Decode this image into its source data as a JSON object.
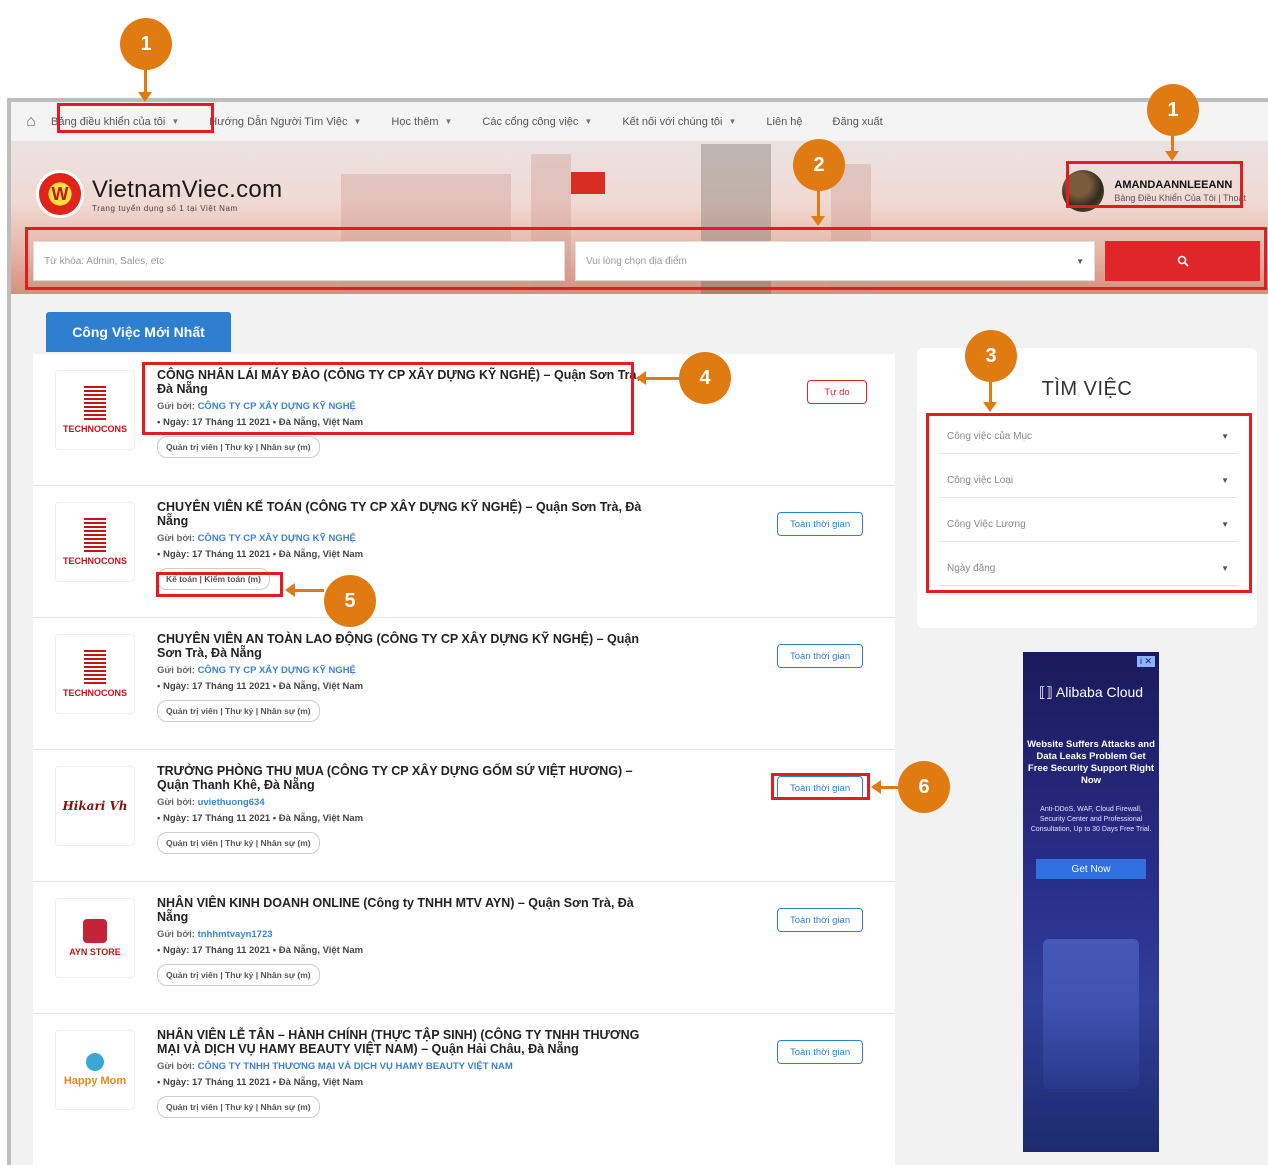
{
  "nav": {
    "items": [
      {
        "label": "Bảng điều khiển của tôi"
      },
      {
        "label": "Hướng Dẫn Người Tìm Việc"
      },
      {
        "label": "Học thêm"
      },
      {
        "label": "Các cổng công việc"
      },
      {
        "label": "Kết nối với chúng tôi"
      },
      {
        "label": "Liên hệ"
      },
      {
        "label": "Đăng xuất"
      }
    ]
  },
  "brand": {
    "name": "VietnamViec.com",
    "tagline": "Trang tuyển dụng số 1 tại Việt Nam",
    "logo_letter": "W"
  },
  "user": {
    "name": "AMANDAANNLEEANN",
    "dashboard": "Bảng Điều Khiển Của Tôi",
    "sep": "|",
    "logout": "Thoát"
  },
  "search": {
    "keyword_placeholder": "Từ khóa: Admin, Sales, etc",
    "location_placeholder": "Vui lòng chọn địa điểm",
    "button_icon": "search-icon"
  },
  "tab": {
    "label": "Công Việc Mới Nhất"
  },
  "jobs": [
    {
      "title": "CÔNG NHÂN LÁI MÁY ĐÀO (CÔNG TY CP XÂY DỰNG KỸ NGHỆ) – Quận Sơn Trà, Đà Nẵng",
      "poster_prefix": "Gửi bởi:",
      "poster": "CÔNG TY CP XÂY DỰNG KỸ NGHỆ",
      "date": "Ngày: 17 Tháng 11 2021",
      "location": "Đà Nẵng, Việt Nam",
      "tag": "Quản trị viên | Thư ký | Nhân sự (m)",
      "badge": "Tự do",
      "logo": "TECHNOCONS"
    },
    {
      "title": "CHUYÊN VIÊN KẾ TOÁN (CÔNG TY CP XÂY DỰNG KỸ NGHỆ) – Quận Sơn Trà, Đà Nẵng",
      "poster_prefix": "Gửi bởi:",
      "poster": "CÔNG TY CP XÂY DỰNG KỸ NGHỆ",
      "date": "Ngày: 17 Tháng 11 2021",
      "location": "Đà Nẵng, Việt Nam",
      "tag": "Kế toán | Kiểm toán (m)",
      "badge": "Toàn thời gian",
      "logo": "TECHNOCONS"
    },
    {
      "title": "CHUYÊN VIÊN AN TOÀN LAO ĐỘNG (CÔNG TY CP XÂY DỰNG KỸ NGHỆ) – Quận Sơn Trà, Đà Nẵng",
      "poster_prefix": "Gửi bởi:",
      "poster": "CÔNG TY CP XÂY DỰNG KỸ NGHỆ",
      "date": "Ngày: 17 Tháng 11 2021",
      "location": "Đà Nẵng, Việt Nam",
      "tag": "Quản trị viên | Thư ký | Nhân sự (m)",
      "badge": "Toàn thời gian",
      "logo": "TECHNOCONS"
    },
    {
      "title": "TRƯỞNG PHÒNG THU MUA (CÔNG TY CP XÂY DỰNG GỐM SỨ VIỆT HƯƠNG) – Quận Thanh Khê, Đà Nẵng",
      "poster_prefix": "Gửi bởi:",
      "poster": "uviethuong634",
      "date": "Ngày: 17 Tháng 11 2021",
      "location": "Đà Nẵng, Việt Nam",
      "tag": "Quản trị viên | Thư ký | Nhân sự (m)",
      "badge": "Toàn thời gian",
      "logo": "Hikari Vh"
    },
    {
      "title": "NHÂN VIÊN KINH DOANH ONLINE (Công ty TNHH MTV AYN) – Quận Sơn Trà, Đà Nẵng",
      "poster_prefix": "Gửi bởi:",
      "poster": "tnhhmtvayn1723",
      "date": "Ngày: 17 Tháng 11 2021",
      "location": "Đà Nẵng, Việt Nam",
      "tag": "Quản trị viên | Thư ký | Nhân sự (m)",
      "badge": "Toàn thời gian",
      "logo": "AYN STORE"
    },
    {
      "title": "NHÂN VIÊN LỄ TÂN – HÀNH CHÍNH (THỰC TẬP SINH) (CÔNG TY TNHH THƯƠNG MẠI VÀ DỊCH VỤ HAMY BEAUTY VIỆT NAM) – Quận Hải Châu, Đà Nẵng",
      "poster_prefix": "Gửi bởi:",
      "poster": "CÔNG TY TNHH THƯƠNG MẠI VÀ DỊCH VỤ HAMY BEAUTY VIỆT NAM",
      "date": "Ngày: 17 Tháng 11 2021",
      "location": "Đà Nẵng, Việt Nam",
      "tag": "Quản trị viên | Thư ký | Nhân sự (m)",
      "badge": "Toàn thời gian",
      "logo": "Happy Mom"
    }
  ],
  "sidebar": {
    "title": "TÌM VIỆC",
    "filters": [
      {
        "label": "Công việc của Mục"
      },
      {
        "label": "Công việc Loại"
      },
      {
        "label": "Công Việc Lương"
      },
      {
        "label": "Ngày đăng"
      }
    ]
  },
  "ad": {
    "brand": "Alibaba Cloud",
    "headline": "Website Suffers Attacks and Data Leaks Problem Get Free Security Support Right Now",
    "body": "Anti-DDoS, WAF, Cloud Firewall, Security Center and Professional Consultation, Up to 30 Days Free Trial.",
    "cta": "Get Now"
  },
  "annotations": [
    "1",
    "1",
    "2",
    "3",
    "4",
    "5",
    "6"
  ],
  "colors": {
    "accent_blue": "#2f7fd1",
    "accent_red": "#e02629",
    "marker_orange": "#e07b12",
    "highlight_red": "#e21c22"
  }
}
